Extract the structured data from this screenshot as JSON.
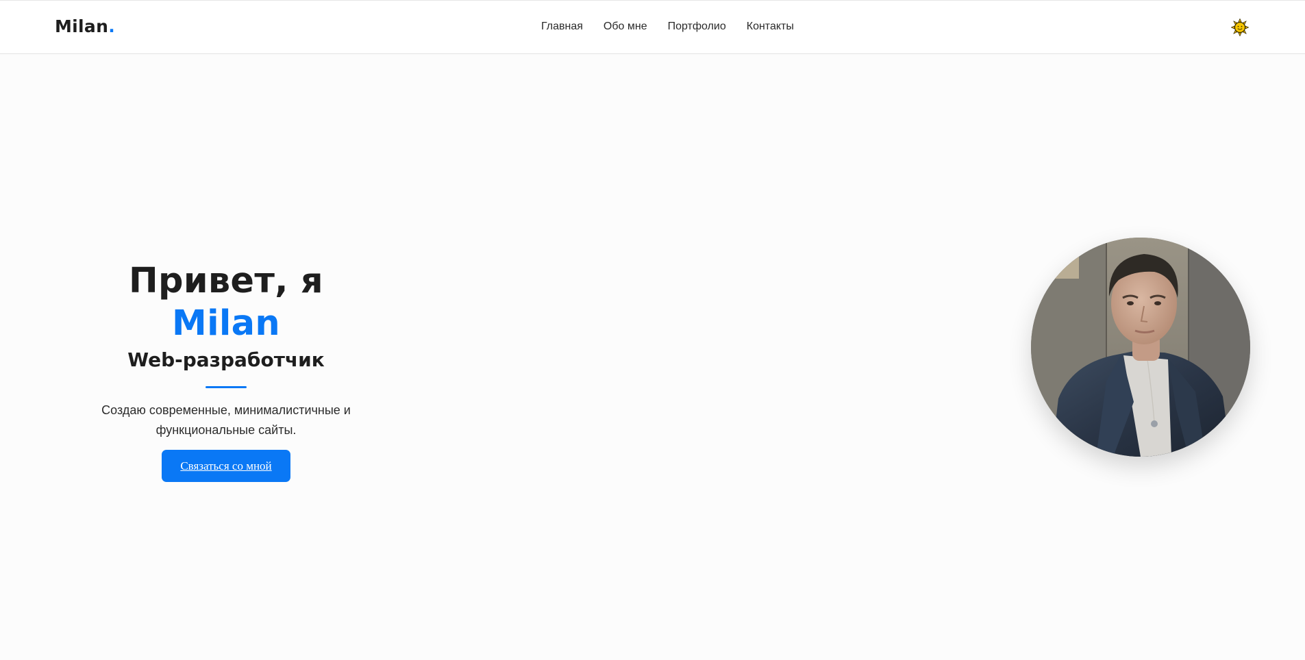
{
  "header": {
    "logo_text": "Milan",
    "logo_dot": ".",
    "nav": [
      {
        "label": "Главная"
      },
      {
        "label": "Обо мне"
      },
      {
        "label": "Портфолио"
      },
      {
        "label": "Контакты"
      }
    ],
    "theme_icon": "sun-icon"
  },
  "hero": {
    "title_prefix": "Привет, я ",
    "title_name": "Milan",
    "subtitle": "Web-разработчик",
    "description": "Создаю современные, минималистичные и функциональные сайты.",
    "cta_label": "Связаться со мной"
  },
  "colors": {
    "accent": "#0a78f5",
    "text": "#1e1e1e",
    "background": "#fcfcfc",
    "header_background": "#ffffff"
  }
}
